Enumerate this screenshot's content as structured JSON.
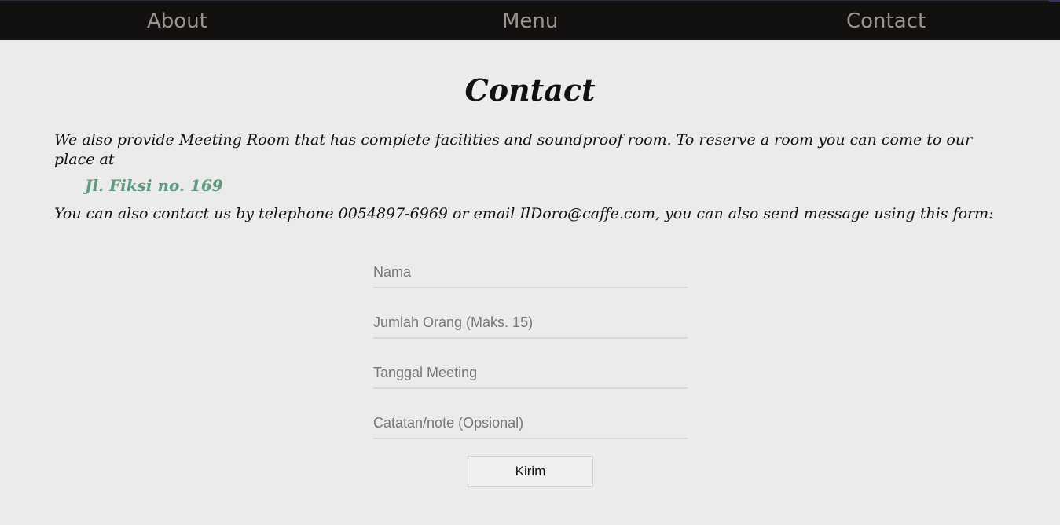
{
  "nav": {
    "about": "About",
    "menu": "Menu",
    "contact": "Contact"
  },
  "main": {
    "title": "Contact",
    "intro": "We also provide Meeting Room that has complete facilities and soundproof room. To reserve a room you can come to our place at",
    "address": "Jl. Fiksi no. 169",
    "contact_text": "You can also contact us by telephone 0054897-6969 or email IlDoro@caffe.com, you can also send message using this form:"
  },
  "form": {
    "name_placeholder": "Nama",
    "people_placeholder": "Jumlah Orang (Maks. 15)",
    "date_placeholder": "Tanggal Meeting",
    "note_placeholder": "Catatan/note (Opsional)",
    "submit_label": "Kirim"
  },
  "colors": {
    "nav_background": "#131110",
    "nav_text": "#9a9592",
    "page_background": "#ebebeb",
    "address_accent": "#5f9a7e"
  }
}
